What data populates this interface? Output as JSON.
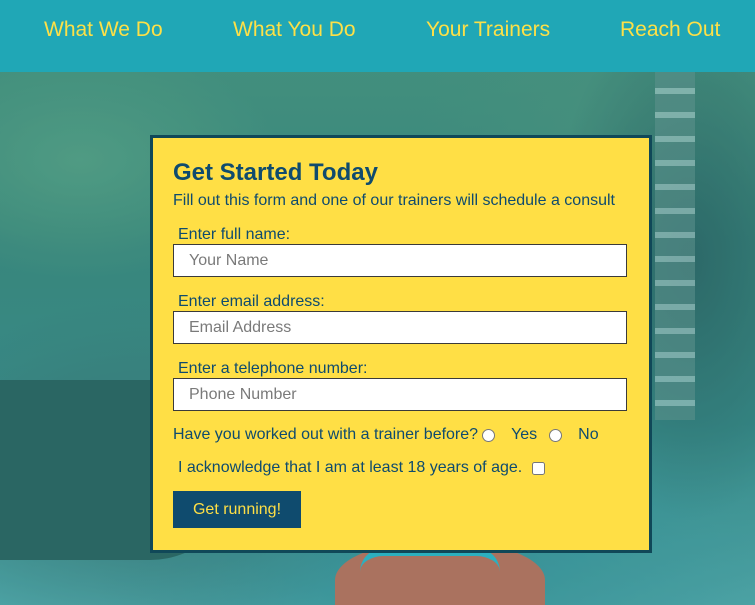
{
  "nav": {
    "items": [
      {
        "label": "What We Do"
      },
      {
        "label": "What You Do"
      },
      {
        "label": "Your Trainers"
      },
      {
        "label": "Reach Out"
      }
    ]
  },
  "form": {
    "title": "Get Started Today",
    "subtitle": "Fill out this form and one of our trainers will schedule a consult",
    "name": {
      "label": "Enter full name:",
      "placeholder": "Your Name",
      "value": ""
    },
    "email": {
      "label": "Enter email address:",
      "placeholder": "Email Address",
      "value": ""
    },
    "phone": {
      "label": "Enter a telephone number:",
      "placeholder": "Phone Number",
      "value": ""
    },
    "trainer_question": {
      "label": "Have you worked out with a trainer before?",
      "options": [
        {
          "label": "Yes",
          "checked": false
        },
        {
          "label": "No",
          "checked": false
        }
      ]
    },
    "acknowledge": {
      "label": "I acknowledge that I am at least 18 years of age.",
      "checked": false
    },
    "submit_label": "Get running!"
  },
  "colors": {
    "nav_background": "#20a7b6",
    "nav_text": "#fde047",
    "card_background": "#ffdf45",
    "card_border": "#104858",
    "primary_text": "#0f4b6e",
    "button_background": "#0f4b6e",
    "button_text": "#ffdf45"
  }
}
